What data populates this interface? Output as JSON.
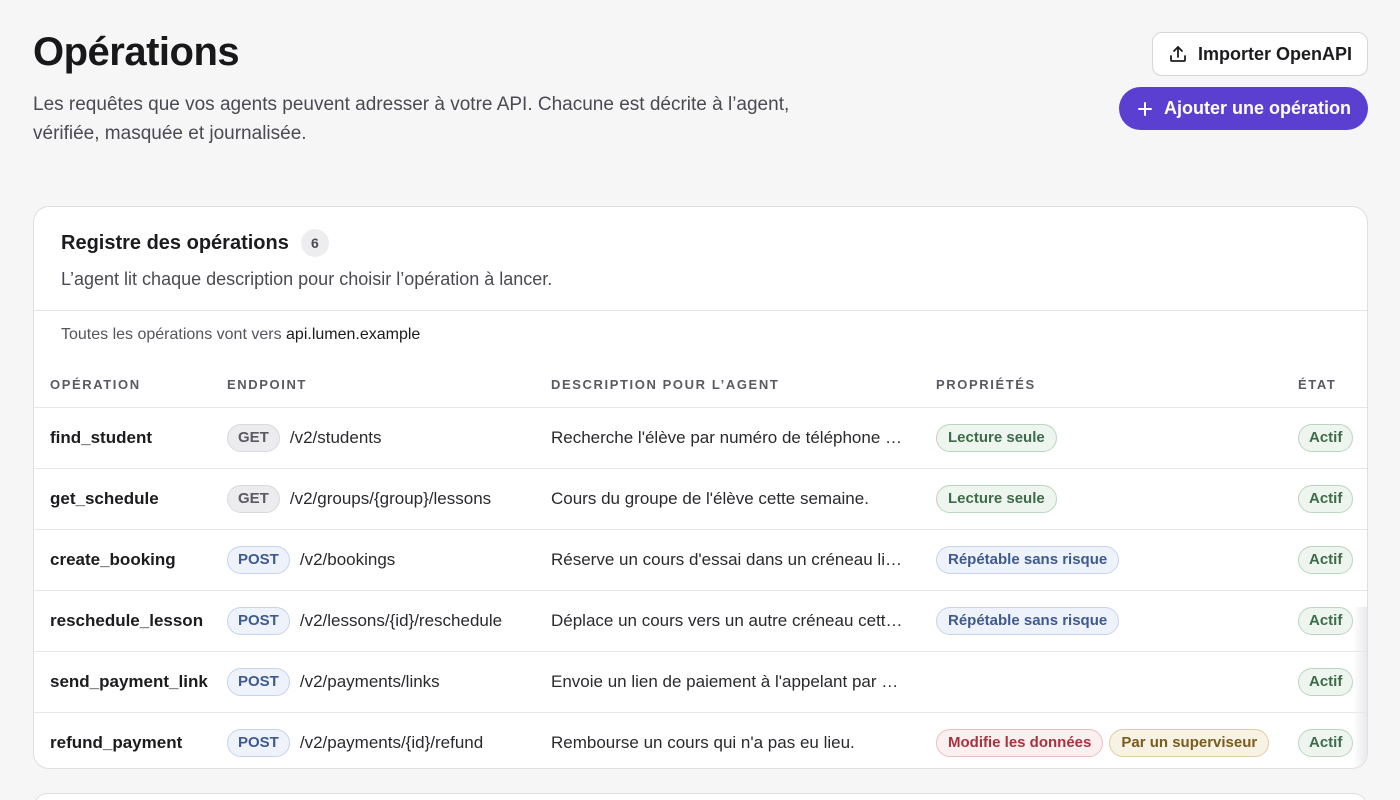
{
  "header": {
    "title": "Opérations",
    "subtitle": "Les requêtes que vos agents peuvent adresser à votre API. Chacune est décrite à l’agent, vérifiée, masquée et journalisée.",
    "import_label": "Importer OpenAPI",
    "import_icon": "upload-icon",
    "add_label": "Ajouter une opération",
    "add_icon": "plus-icon",
    "accent_color": "#5a3fd1"
  },
  "registry": {
    "title": "Registre des opérations",
    "count": "6",
    "description": "L’agent lit chaque description pour choisir l’opération à lancer.",
    "routing_prefix": "Toutes les opérations vont vers",
    "routing_host": "api.lumen.example",
    "columns": [
      "OPÉRATION",
      "ENDPOINT",
      "DESCRIPTION POUR L’AGENT",
      "PROPRIÉTÉS",
      "ÉTAT"
    ],
    "rows": [
      {
        "name": "find_student",
        "method": "GET",
        "path": "/v2/students",
        "description": "Recherche l'élève par numéro de téléphone o…",
        "properties": [
          {
            "label": "Lecture seule",
            "kind": "read"
          }
        ],
        "state": "Actif"
      },
      {
        "name": "get_schedule",
        "method": "GET",
        "path": "/v2/groups/{group}/lessons",
        "description": "Cours du groupe de l'élève cette semaine.",
        "properties": [
          {
            "label": "Lecture seule",
            "kind": "read"
          }
        ],
        "state": "Actif"
      },
      {
        "name": "create_booking",
        "method": "POST",
        "path": "/v2/bookings",
        "description": "Réserve un cours d'essai dans un créneau lib…",
        "properties": [
          {
            "label": "Répétable sans risque",
            "kind": "idem"
          }
        ],
        "state": "Actif"
      },
      {
        "name": "reschedule_lesson",
        "method": "POST",
        "path": "/v2/lessons/{id}/reschedule",
        "description": "Déplace un cours vers un autre créneau cett…",
        "properties": [
          {
            "label": "Répétable sans risque",
            "kind": "idem"
          }
        ],
        "state": "Actif"
      },
      {
        "name": "send_payment_link",
        "method": "POST",
        "path": "/v2/payments/links",
        "description": "Envoie un lien de paiement à l'appelant par …",
        "properties": [],
        "state": "Actif"
      },
      {
        "name": "refund_payment",
        "method": "POST",
        "path": "/v2/payments/{id}/refund",
        "description": "Rembourse un cours qui n'a pas eu lieu.",
        "properties": [
          {
            "label": "Modifie les données",
            "kind": "mod"
          },
          {
            "label": "Par un superviseur",
            "kind": "sup"
          }
        ],
        "state": "Actif"
      }
    ]
  }
}
